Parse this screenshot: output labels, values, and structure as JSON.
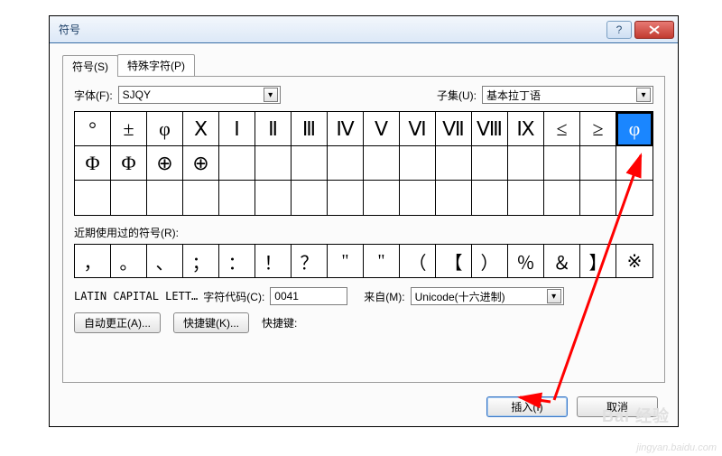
{
  "window": {
    "title": "符号"
  },
  "tabs": {
    "symbol": "符号(S)",
    "special": "特殊字符(P)"
  },
  "font": {
    "label": "字体(F):",
    "value": "SJQY"
  },
  "subset": {
    "label": "子集(U):",
    "value": "基本拉丁语"
  },
  "grid_symbols": [
    "°",
    "±",
    "φ",
    "Ⅹ",
    "Ⅰ",
    "Ⅱ",
    "Ⅲ",
    "Ⅳ",
    "Ⅴ",
    "Ⅵ",
    "Ⅶ",
    "Ⅷ",
    "Ⅸ",
    "≤",
    "≥",
    "φ",
    "Φ",
    "Φ",
    "⊕",
    "⊕",
    "",
    "",
    "",
    "",
    "",
    "",
    "",
    "",
    "",
    "",
    "",
    "",
    "",
    "",
    "",
    "",
    "",
    "",
    "",
    "",
    "",
    "",
    "",
    "",
    "",
    "",
    "",
    ""
  ],
  "selected_index": 15,
  "recent_label": "近期使用过的符号(R):",
  "recent": [
    "，",
    "。",
    "、",
    "；",
    "：",
    "！",
    "？",
    "\"",
    "\"",
    "（",
    "【",
    "）",
    "％",
    "＆",
    "】",
    "※"
  ],
  "char_name": {
    "label": "LATIN CAPITAL LETT…"
  },
  "char_code": {
    "label": "字符代码(C):",
    "value": "0041"
  },
  "from": {
    "label": "来自(M):",
    "value": "Unicode(十六进制)"
  },
  "buttons": {
    "autocorrect": "自动更正(A)...",
    "shortcut_btn": "快捷键(K)...",
    "shortcut_label": "快捷键:",
    "insert": "插入(I)",
    "cancel": "取消"
  },
  "watermark": {
    "badge": "Bai 经验",
    "url": "jingyan.baidu.com"
  }
}
